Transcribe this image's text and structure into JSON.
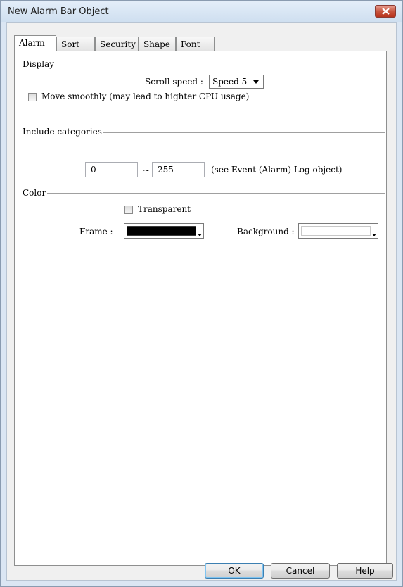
{
  "window": {
    "title": "New Alarm Bar Object"
  },
  "tabs": [
    {
      "label": "Alarm",
      "active": true
    },
    {
      "label": "Sort"
    },
    {
      "label": "Security"
    },
    {
      "label": "Shape"
    },
    {
      "label": "Font"
    }
  ],
  "display": {
    "group_label": "Display",
    "scroll_speed_label": "Scroll speed :",
    "scroll_speed_value": "Speed 5",
    "move_smoothly_label": "Move smoothly (may lead to highter CPU usage)",
    "move_smoothly_checked": false
  },
  "include_categories": {
    "group_label": "Include categories",
    "from_value": "0",
    "separator": "~",
    "to_value": "255",
    "note": "(see Event (Alarm) Log object)"
  },
  "color": {
    "group_label": "Color",
    "transparent_label": "Transparent",
    "transparent_checked": false,
    "frame_label": "Frame :",
    "frame_color": "#000000",
    "background_label": "Background :",
    "background_color": "#ffffff"
  },
  "buttons": {
    "ok": "OK",
    "cancel": "Cancel",
    "help": "Help"
  }
}
